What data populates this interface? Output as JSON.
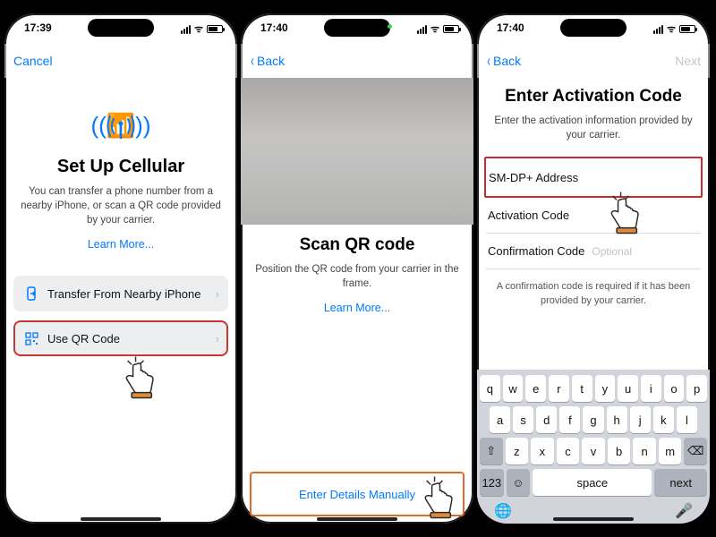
{
  "screen1": {
    "status_time": "17:39",
    "nav_cancel": "Cancel",
    "title": "Set Up Cellular",
    "subtitle": "You can transfer a phone number from a nearby iPhone, or scan a QR code provided by your carrier.",
    "learn_more": "Learn More...",
    "row1_label": "Transfer From Nearby iPhone",
    "row2_label": "Use QR Code"
  },
  "screen2": {
    "status_time": "17:40",
    "nav_back": "Back",
    "title": "Scan QR code",
    "subtitle": "Position the QR code from your carrier in the frame.",
    "learn_more": "Learn More...",
    "manual_link": "Enter Details Manually"
  },
  "screen3": {
    "status_time": "17:40",
    "nav_back": "Back",
    "nav_next": "Next",
    "title": "Enter Activation Code",
    "subtitle": "Enter the activation information provided by your carrier.",
    "field1": "SM-DP+ Address",
    "field2": "Activation Code",
    "field3": "Confirmation Code",
    "field3_hint": "Optional",
    "note": "A confirmation code is required if it has been provided by your carrier.",
    "kb_rows": [
      [
        "q",
        "w",
        "e",
        "r",
        "t",
        "y",
        "u",
        "i",
        "o",
        "p"
      ],
      [
        "a",
        "s",
        "d",
        "f",
        "g",
        "h",
        "j",
        "k",
        "l"
      ],
      [
        "z",
        "x",
        "c",
        "v",
        "b",
        "n",
        "m"
      ]
    ],
    "kb_shift": "⇧",
    "kb_bksp": "⌫",
    "kb_123": "123",
    "kb_emoji": "☺",
    "kb_space": "space",
    "kb_next": "next",
    "kb_globe": "🌐",
    "kb_mic": "🎤"
  }
}
